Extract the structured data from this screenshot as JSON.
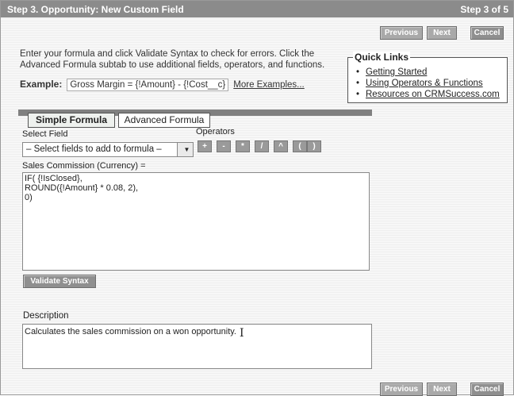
{
  "header": {
    "title": "Step 3. Opportunity: New Custom Field",
    "step": "Step 3 of 5"
  },
  "nav": {
    "previous": "Previous",
    "next": "Next",
    "cancel": "Cancel"
  },
  "intro": {
    "line1": "Enter your formula and click Validate Syntax to check for errors. Click the",
    "line2": "Advanced Formula subtab to use additional fields, operators, and functions."
  },
  "example": {
    "label": "Example:",
    "value": "Gross Margin = {!Amount} - {!Cost__c}",
    "more_link": "More Examples..."
  },
  "quick_links": {
    "title": "Quick Links",
    "items": [
      "Getting Started",
      "Using Operators & Functions",
      "Resources on CRMSuccess.com"
    ]
  },
  "tabs": {
    "simple": "Simple Formula",
    "advanced": "Advanced Formula"
  },
  "select_field": {
    "label": "Select Field",
    "value": "– Select fields to add to formula –"
  },
  "operators": {
    "label": "Operators",
    "items": [
      "+",
      "-",
      "*",
      "/",
      "^",
      "(",
      ")"
    ]
  },
  "formula": {
    "label": "Sales Commission (Currency) =",
    "value": "IF( {!IsClosed},\nROUND({!Amount} * 0.08, 2),\n0)"
  },
  "validate_button": "Validate Syntax",
  "description": {
    "label": "Description",
    "value": "Calculates the sales commission on a won opportunity."
  },
  "icons": {
    "dropdown": "chevron-down-icon",
    "text_cursor": "text-cursor-icon"
  }
}
